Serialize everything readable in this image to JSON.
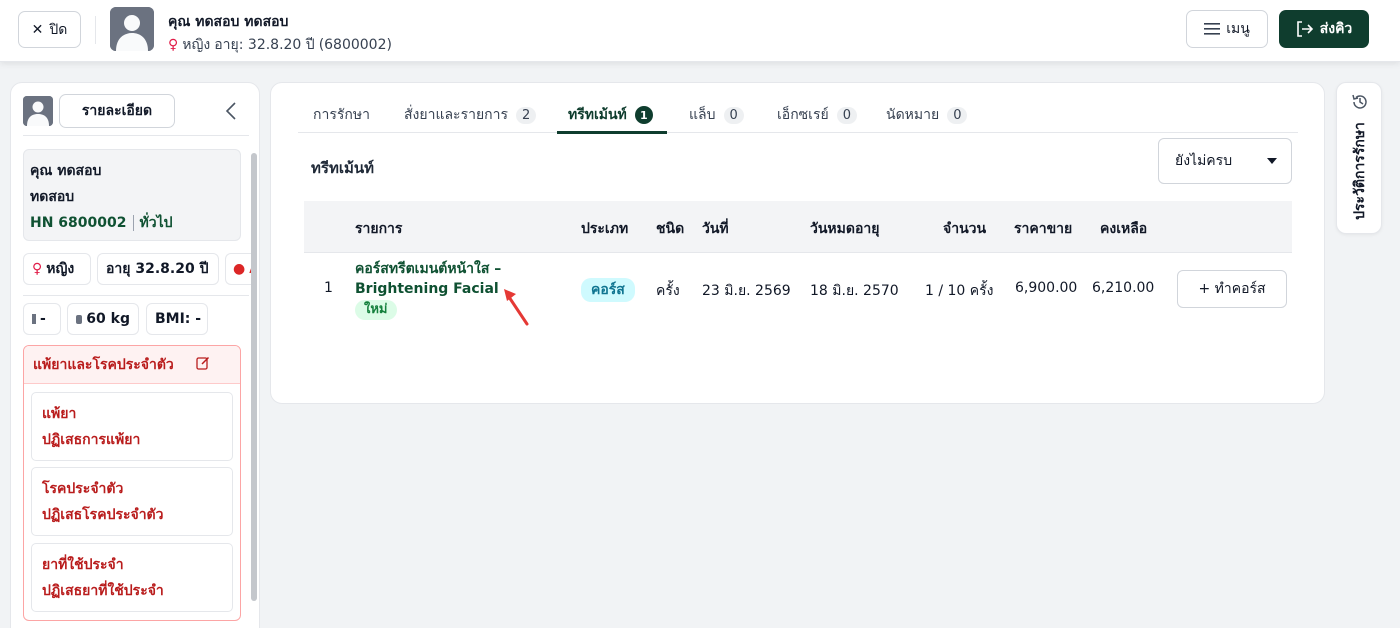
{
  "header": {
    "close_label": "ปิด",
    "patient_name": "คุณ ทดสอบ ทดสอบ",
    "gender": "หญิง",
    "age_text": "อายุ: 32.8.20 ปี",
    "patient_code": "(6800002)",
    "menu_label": "เมนู",
    "send_label": "ส่งคิว"
  },
  "sidebar": {
    "detail_button": "รายละเอียด",
    "name_line1": "คุณ ทดสอบ",
    "name_line2": "ทดสอบ",
    "hn": "HN 6800002",
    "patient_type": "ทั่วไป",
    "gender": "หญิง",
    "age": "อายุ 32.8.20 ปี",
    "blood_partial": "A",
    "height": "-",
    "weight": "60 kg",
    "bmi": "BMI: -",
    "allergy_section": {
      "title": "แพ้ยาและโรคประจำตัว",
      "items": [
        {
          "label": "แพ้ยา",
          "value": "ปฏิเสธการแพ้ยา"
        },
        {
          "label": "โรคประจำตัว",
          "value": "ปฏิเสธโรคประจำตัว"
        },
        {
          "label": "ยาที่ใช้ประจำ",
          "value": "ปฏิเสธยาที่ใช้ประจำ"
        }
      ]
    }
  },
  "tabs": [
    {
      "label": "การรักษา",
      "count": ""
    },
    {
      "label": "สั่งยาและรายการ",
      "count": "2"
    },
    {
      "label": "ทรีทเม้นท์",
      "count": "1"
    },
    {
      "label": "แล็บ",
      "count": "0"
    },
    {
      "label": "เอ็กซเรย์",
      "count": "0"
    },
    {
      "label": "นัดหมาย",
      "count": "0"
    }
  ],
  "active_tab": "ทรีทเม้นท์",
  "section": {
    "title": "ทรีทเม้นท์",
    "filter_value": "ยังไม่ครบ"
  },
  "table": {
    "headers": [
      "รายการ",
      "ประเภท",
      "ชนิด",
      "วันที่",
      "วันหมดอายุ",
      "จำนวน",
      "ราคาขาย",
      "คงเหลือ"
    ],
    "rows": [
      {
        "index": "1",
        "name": "คอร์สทรีตเมนต์หน้าใส – Brightening Facial",
        "badge": "ใหม่",
        "type": "คอร์ส",
        "unit": "ครั้ง",
        "date": "23 มิ.ย. 2569",
        "expiry": "18 มิ.ย. 2570",
        "quantity": "1 / 10 ครั้ง",
        "price": "6,900.00",
        "remaining": "6,210.00",
        "action_label": "+ ทำคอร์ส"
      }
    ]
  },
  "history_tab": {
    "label": "ประวัติการรักษา"
  },
  "colors": {
    "primary": "#0f3d2e",
    "allergy_red": "#b91c1c",
    "annotation_arrow": "#e53935"
  }
}
